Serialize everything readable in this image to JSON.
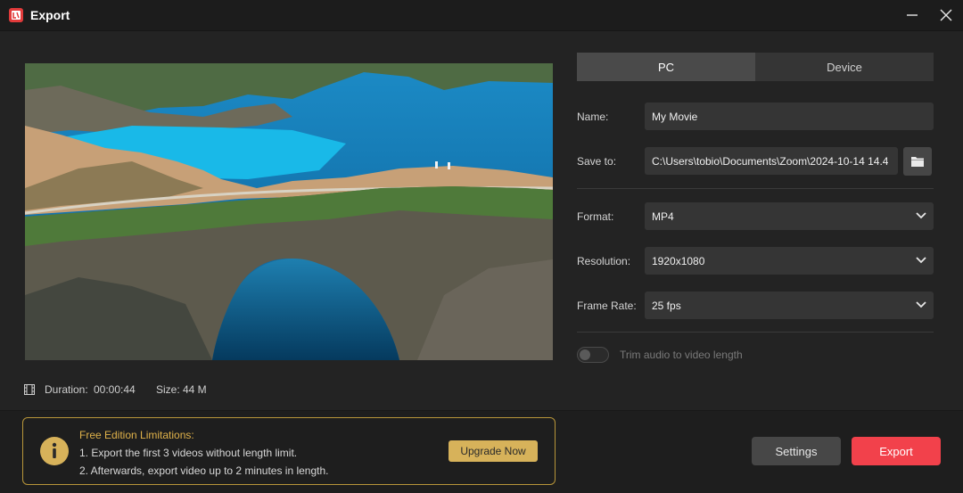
{
  "window": {
    "title": "Export",
    "minimize_icon": "minimize-icon",
    "close_icon": "close-icon",
    "logo_icon": "app-logo-icon"
  },
  "preview": {
    "image_description_icon": "video-preview",
    "duration_label": "Duration:",
    "duration_value": "00:00:44",
    "size_label": "Size:",
    "size_value": "44 M"
  },
  "tabs": [
    {
      "label": "PC",
      "active": true
    },
    {
      "label": "Device",
      "active": false
    }
  ],
  "form": {
    "name_label": "Name:",
    "name_value": "My Movie",
    "save_to_label": "Save to:",
    "save_to_value": "C:\\Users\\tobio\\Documents\\Zoom\\2024-10-14 14.4",
    "format_label": "Format:",
    "format_value": "MP4",
    "resolution_label": "Resolution:",
    "resolution_value": "1920x1080",
    "frame_rate_label": "Frame Rate:",
    "frame_rate_value": "25 fps",
    "trim_audio_label": "Trim audio to video length",
    "trim_audio_enabled": false
  },
  "notice": {
    "title": "Free Edition Limitations:",
    "line1": "1. Export the first 3 videos without length limit.",
    "line2": "2. Afterwards, export video up to 2 minutes in length.",
    "upgrade_label": "Upgrade Now"
  },
  "actions": {
    "settings_label": "Settings",
    "export_label": "Export"
  },
  "colors": {
    "accent": "#f2414b",
    "gold": "#d7b25a",
    "background": "#232323"
  }
}
